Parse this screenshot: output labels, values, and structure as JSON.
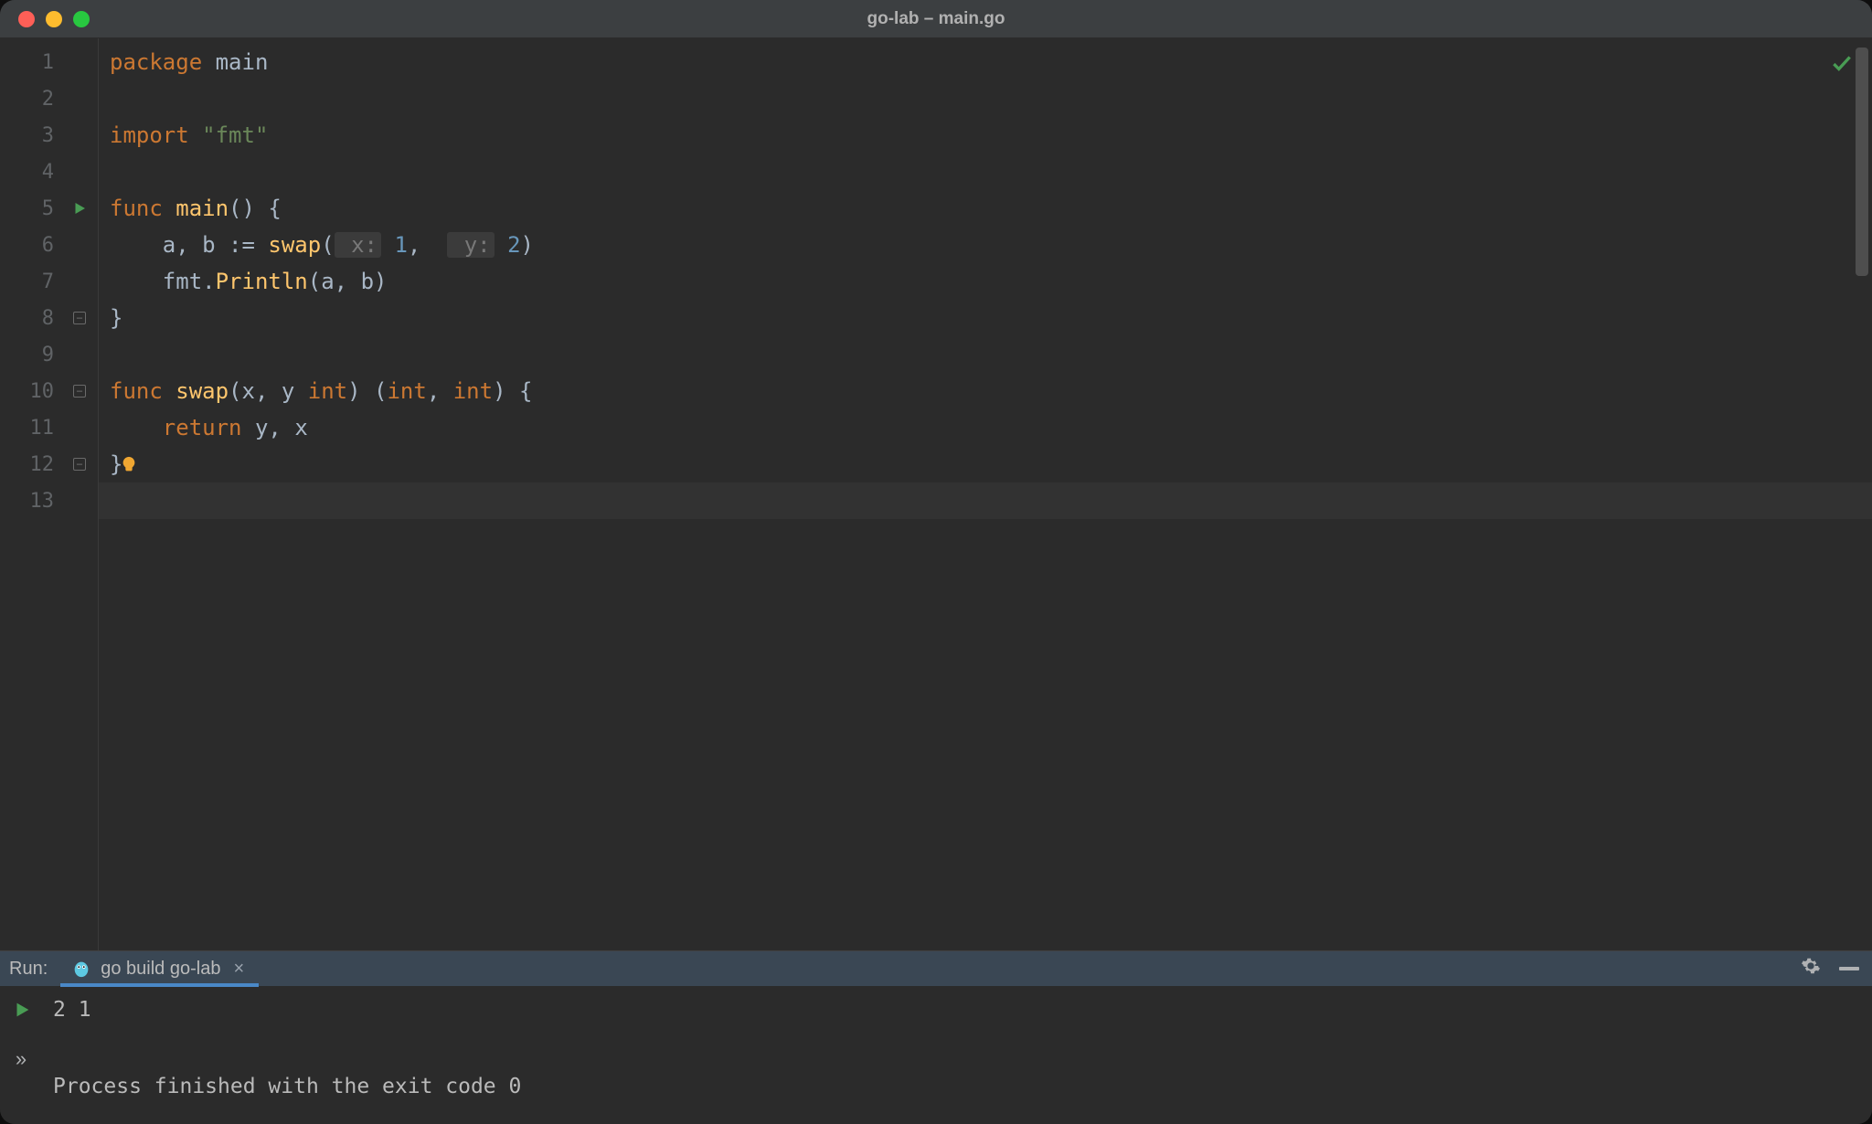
{
  "window": {
    "title": "go-lab – main.go"
  },
  "gutter": {
    "numbers": [
      "1",
      "2",
      "3",
      "4",
      "5",
      "6",
      "7",
      "8",
      "9",
      "10",
      "11",
      "12",
      "13"
    ],
    "runnable_lines": [
      5
    ],
    "fold_lines": [
      5,
      8,
      10,
      12
    ]
  },
  "editor": {
    "lines": [
      {
        "tokens": [
          {
            "t": "package ",
            "c": "kw"
          },
          {
            "t": "main",
            "c": "ident"
          }
        ]
      },
      {
        "tokens": []
      },
      {
        "tokens": [
          {
            "t": "import ",
            "c": "kw"
          },
          {
            "t": "\"fmt\"",
            "c": "str"
          }
        ]
      },
      {
        "tokens": []
      },
      {
        "tokens": [
          {
            "t": "func ",
            "c": "kw"
          },
          {
            "t": "main",
            "c": "fn"
          },
          {
            "t": "() {",
            "c": "paren"
          }
        ]
      },
      {
        "tokens": [
          {
            "t": "    ",
            "c": "ident"
          },
          {
            "t": "a",
            "c": "ident"
          },
          {
            "t": ", ",
            "c": "op"
          },
          {
            "t": "b",
            "c": "ident"
          },
          {
            "t": " := ",
            "c": "op"
          },
          {
            "t": "swap",
            "c": "fn"
          },
          {
            "t": "(",
            "c": "paren"
          },
          {
            "t": " x:",
            "c": "hint"
          },
          {
            "t": " 1",
            "c": "num"
          },
          {
            "t": ",  ",
            "c": "op"
          },
          {
            "t": " y:",
            "c": "hint"
          },
          {
            "t": " 2",
            "c": "num"
          },
          {
            "t": ")",
            "c": "paren"
          }
        ]
      },
      {
        "tokens": [
          {
            "t": "    ",
            "c": "ident"
          },
          {
            "t": "fmt",
            "c": "ident"
          },
          {
            "t": ".",
            "c": "op"
          },
          {
            "t": "Println",
            "c": "fn"
          },
          {
            "t": "(",
            "c": "paren"
          },
          {
            "t": "a",
            "c": "ident"
          },
          {
            "t": ", ",
            "c": "op"
          },
          {
            "t": "b",
            "c": "ident"
          },
          {
            "t": ")",
            "c": "paren"
          }
        ]
      },
      {
        "tokens": [
          {
            "t": "}",
            "c": "paren"
          }
        ]
      },
      {
        "tokens": []
      },
      {
        "tokens": [
          {
            "t": "func ",
            "c": "kw"
          },
          {
            "t": "swap",
            "c": "fn"
          },
          {
            "t": "(",
            "c": "paren"
          },
          {
            "t": "x",
            "c": "ident"
          },
          {
            "t": ", ",
            "c": "op"
          },
          {
            "t": "y",
            "c": "ident"
          },
          {
            "t": " int",
            "c": "type"
          },
          {
            "t": ") (",
            "c": "paren"
          },
          {
            "t": "int",
            "c": "type"
          },
          {
            "t": ", ",
            "c": "op"
          },
          {
            "t": "int",
            "c": "type"
          },
          {
            "t": ") {",
            "c": "paren"
          }
        ]
      },
      {
        "tokens": [
          {
            "t": "    ",
            "c": "ident"
          },
          {
            "t": "return ",
            "c": "kw"
          },
          {
            "t": "y",
            "c": "ident"
          },
          {
            "t": ", ",
            "c": "op"
          },
          {
            "t": "x",
            "c": "ident"
          }
        ]
      },
      {
        "tokens": [
          {
            "t": "}",
            "c": "paren"
          }
        ],
        "bulb": true
      },
      {
        "tokens": [],
        "active": true
      }
    ],
    "status": "ok"
  },
  "run_panel": {
    "label": "Run:",
    "tab": {
      "icon": "gopher",
      "name": "go build go-lab"
    },
    "output": [
      "2 1",
      "",
      "Process finished with the exit code 0"
    ]
  }
}
